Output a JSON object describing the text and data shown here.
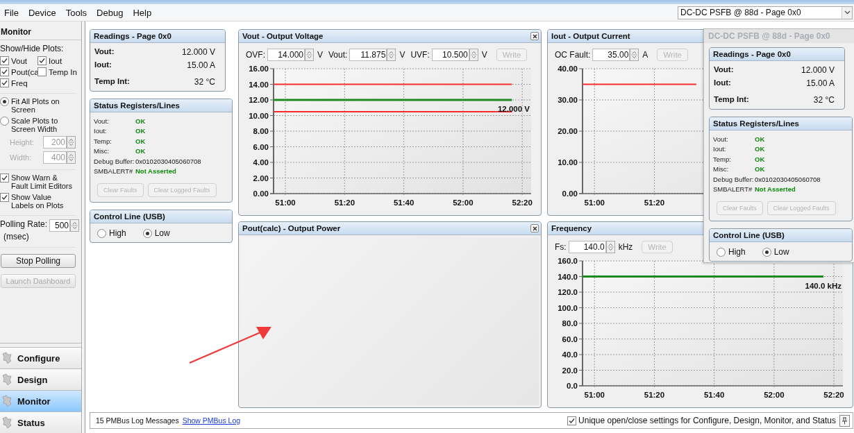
{
  "menu": [
    "File",
    "Device",
    "Tools",
    "Debug",
    "Help"
  ],
  "device_select": {
    "value": "DC-DC PSFB @ 88d - Page 0x0"
  },
  "sidebar": {
    "title": "Monitor",
    "plots_label": "Show/Hide Plots:",
    "plot_toggles": [
      {
        "label": "Vout",
        "checked": true
      },
      {
        "label": "Iout",
        "checked": true
      },
      {
        "label": "Pout(ca",
        "checked": true
      },
      {
        "label": "Temp In",
        "checked": false
      },
      {
        "label": "Freq",
        "checked": true
      }
    ],
    "scale_options": [
      {
        "label": "Fit All Plots on Screen",
        "selected": true
      },
      {
        "label": "Scale Plots to Screen Width",
        "selected": false
      }
    ],
    "size_fields": [
      {
        "label": "Height:",
        "value": "200",
        "disabled": true
      },
      {
        "label": "Width:",
        "value": "400",
        "disabled": true
      }
    ],
    "options": [
      {
        "label": "Show Warn & Fault Limit Editors",
        "checked": true
      },
      {
        "label": "Show Value Labels on Plots",
        "checked": true
      }
    ],
    "polling": {
      "label": "Polling Rate:",
      "unit": "(msec)",
      "value": "500"
    },
    "buttons": [
      {
        "label": "Stop Polling",
        "disabled": false
      },
      {
        "label": "Launch Dashboard",
        "disabled": true
      }
    ],
    "nav": [
      {
        "label": "Configure",
        "selected": false
      },
      {
        "label": "Design",
        "selected": false
      },
      {
        "label": "Monitor",
        "selected": true
      },
      {
        "label": "Status",
        "selected": false
      }
    ]
  },
  "readings": {
    "title": "Readings - Page 0x0",
    "rows": [
      {
        "label": "Vout:",
        "value": "12.000 V"
      },
      {
        "label": "Iout:",
        "value": "15.00 A"
      },
      {
        "label": "Temp Int:",
        "value": "32 °C"
      }
    ]
  },
  "status": {
    "title": "Status Registers/Lines",
    "rows": [
      {
        "label": "Vout:",
        "value": "OK",
        "kind": "ok"
      },
      {
        "label": "Iout:",
        "value": "OK",
        "kind": "ok"
      },
      {
        "label": "Temp:",
        "value": "OK",
        "kind": "ok"
      },
      {
        "label": "Misc:",
        "value": "OK",
        "kind": "ok"
      },
      {
        "label": "Debug Buffer:",
        "value": "0x0102030405060708",
        "kind": "plain"
      },
      {
        "label": "SMBALERT#",
        "value": "Not Asserted",
        "kind": "ok"
      }
    ],
    "buttons": [
      {
        "label": "Clear Faults",
        "disabled": true
      },
      {
        "label": "Clear Logged Faults",
        "disabled": true
      }
    ]
  },
  "control_line": {
    "title": "Control Line (USB)",
    "options": [
      {
        "label": "High",
        "selected": false
      },
      {
        "label": "Low",
        "selected": true
      }
    ]
  },
  "plots": [
    {
      "title": "Vout - Output Voltage",
      "closable": true,
      "fields": [
        {
          "label": "OVF:",
          "value": "14.000",
          "unit": "V"
        },
        {
          "label": "Vout:",
          "value": "11.875",
          "unit": "V"
        },
        {
          "label": "UVF:",
          "value": "10.500",
          "unit": "V"
        }
      ],
      "write": {
        "label": "Write",
        "disabled": true
      },
      "chart_data": {
        "type": "line",
        "x": [
          3056,
          3136.5
        ],
        "xlim": [
          3056,
          3143
        ],
        "ylim": [
          0,
          16
        ],
        "xticks": [
          {
            "value": 3060,
            "label": "51:00"
          },
          {
            "value": 3080,
            "label": "51:20"
          },
          {
            "value": 3100,
            "label": "51:40"
          },
          {
            "value": 3120,
            "label": "52:00"
          },
          {
            "value": 3140,
            "label": "52:20"
          }
        ],
        "yticks": [
          {
            "value": 0,
            "label": "0.00"
          },
          {
            "value": 2,
            "label": "2.00"
          },
          {
            "value": 4,
            "label": "4.00"
          },
          {
            "value": 6,
            "label": "6.00"
          },
          {
            "value": 8,
            "label": "8.00"
          },
          {
            "value": 10,
            "label": "10.00"
          },
          {
            "value": 12,
            "label": "12.00"
          },
          {
            "value": 14,
            "label": "14.00"
          },
          {
            "value": 16,
            "label": "16.00"
          }
        ],
        "series": [
          {
            "color": "#ff2a2a",
            "values": [
              14,
              14
            ]
          },
          {
            "color": "#1d8a1d",
            "values": [
              12,
              12
            ]
          },
          {
            "color": "#ff2a2a",
            "values": [
              10.5,
              10.5
            ]
          }
        ],
        "grid": true,
        "annotations": [
          "12.000 V"
        ]
      }
    },
    {
      "title": "Iout - Output Current",
      "fields": [
        {
          "label": "OC Fault:",
          "value": "35.00",
          "unit": "A"
        }
      ],
      "write": {
        "label": "Write",
        "disabled": true
      },
      "chart_data": {
        "type": "line",
        "x": [
          3056,
          3094
        ],
        "xlim": [
          3056,
          3143
        ],
        "ylim": [
          0,
          40
        ],
        "xticks": [
          {
            "value": 3060,
            "label": "51:00"
          },
          {
            "value": 3080,
            "label": "51:20"
          }
        ],
        "yticks": [
          {
            "value": 0,
            "label": "0.00"
          },
          {
            "value": 10,
            "label": "10.00"
          },
          {
            "value": 20,
            "label": "20.00"
          },
          {
            "value": 30,
            "label": "30.00"
          },
          {
            "value": 40,
            "label": "40.00"
          }
        ],
        "series": [
          {
            "color": "#ff2a2a",
            "values": [
              35,
              35
            ]
          }
        ],
        "grid": true
      }
    },
    {
      "title": "Pout(calc) - Output Power",
      "closable": true
    },
    {
      "title": "Frequency",
      "fields": [
        {
          "label": "Fs:",
          "value": "140.0",
          "unit": "kHz"
        }
      ],
      "write": {
        "label": "Write",
        "disabled": true
      },
      "chart_data": {
        "type": "line",
        "x": [
          3056,
          3136.5
        ],
        "xlim": [
          3056,
          3143
        ],
        "ylim": [
          0,
          160
        ],
        "xticks": [
          {
            "value": 3060,
            "label": "51:00"
          },
          {
            "value": 3080,
            "label": "51:20"
          },
          {
            "value": 3100,
            "label": "51:40"
          },
          {
            "value": 3120,
            "label": "52:00"
          },
          {
            "value": 3140,
            "label": "52:20"
          }
        ],
        "yticks": [
          {
            "value": 0,
            "label": "0.0"
          },
          {
            "value": 20,
            "label": "20.0"
          },
          {
            "value": 40,
            "label": "40.0"
          },
          {
            "value": 60,
            "label": "60.0"
          },
          {
            "value": 80,
            "label": "80.0"
          },
          {
            "value": 100,
            "label": "100.0"
          },
          {
            "value": 120,
            "label": "120.0"
          },
          {
            "value": 140,
            "label": "140.0"
          },
          {
            "value": 160,
            "label": "160.0"
          }
        ],
        "series": [
          {
            "color": "#1d8a1d",
            "values": [
              140,
              140
            ]
          }
        ],
        "grid": true,
        "annotations": [
          "140.0 kHz"
        ]
      }
    }
  ],
  "floating_window": {
    "title": "DC-DC PSFB @ 88d - Page 0x0",
    "readings": {
      "title": "Readings - Page 0x0",
      "rows": [
        {
          "label": "Vout:",
          "value": "12.000 V"
        },
        {
          "label": "Iout:",
          "value": "15.00 A"
        },
        {
          "label": "Temp Int:",
          "value": "32 °C"
        }
      ]
    },
    "status": {
      "title": "Status Registers/Lines",
      "rows": [
        {
          "label": "Vout:",
          "value": "OK",
          "kind": "ok"
        },
        {
          "label": "Iout:",
          "value": "OK",
          "kind": "ok"
        },
        {
          "label": "Temp:",
          "value": "OK",
          "kind": "ok"
        },
        {
          "label": "Misc:",
          "value": "OK",
          "kind": "ok"
        },
        {
          "label": "Debug Buffer:",
          "value": "0x0102030405060708",
          "kind": "plain"
        },
        {
          "label": "SMBALERT#",
          "value": "Not Asserted",
          "kind": "ok"
        }
      ],
      "buttons": [
        {
          "label": "Clear Faults",
          "disabled": true
        },
        {
          "label": "Clear Logged Faults",
          "disabled": true
        }
      ]
    },
    "control_line": {
      "title": "Control Line (USB)",
      "options": [
        {
          "label": "High",
          "selected": false
        },
        {
          "label": "Low",
          "selected": true
        }
      ]
    }
  },
  "status_bar": {
    "log_count": "15 PMBus Log Messages",
    "log_link": "Show PMBus Log",
    "unique_setting": {
      "label": "Unique open/close settings for Configure, Design, Monitor, and Status",
      "checked": true
    }
  }
}
